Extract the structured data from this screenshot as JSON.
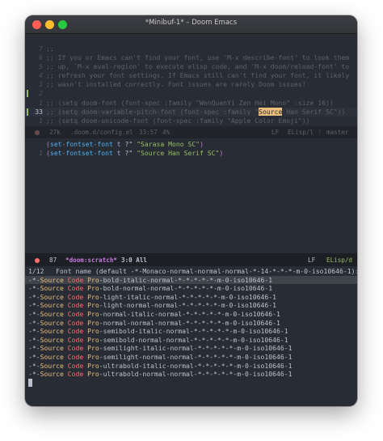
{
  "window": {
    "title": "*Minibuf-1* – Doom Emacs"
  },
  "top_pane": {
    "lines": [
      {
        "num": "7",
        "text": ";;"
      },
      {
        "num": "6",
        "text": ";; If you or Emacs can't find your font, use 'M-x describe-font' to look them"
      },
      {
        "num": "5",
        "text": ";; up, `M-x eval-region' to execute elisp code, and 'M-x doom/reload-font' to"
      },
      {
        "num": "4",
        "text": ";; refresh your font settings. If Emacs still can't find your font, it likely"
      },
      {
        "num": "3",
        "text": ";; wasn't installed correctly. Font issues are rarely Doom issues!"
      },
      {
        "num": "2",
        "text": ""
      },
      {
        "num": "1",
        "text": ";; (setq doom-font (font-spec :family \"WenQuanYi Zen Hei Mono\" :size 16))"
      },
      {
        "num": "33",
        "text_before": ";; (setq doom-variable-pitch-font (font-spec :family \"",
        "text_hl": "Source",
        "text_after": " Han Serif SC\"))"
      },
      {
        "num": "1",
        "text": ";; (setq doom-unicode-font (font-spec :family \"Apple Color Emoji\"))"
      },
      {
        "num": "2",
        "text": ""
      }
    ]
  },
  "top_modeline": {
    "size": "27k",
    "file": ".doom.d/config.el",
    "position": "33:57",
    "percent": "4%",
    "eol": "LF",
    "mode": "ELisp/l",
    "branch": "master"
  },
  "bottom_pane": {
    "lines": [
      {
        "num": "",
        "open": "(",
        "fn": "set-fontset-font",
        "sp1": " ",
        "const": "t",
        "sp2": " ",
        "char": "?\"",
        "sp3": " ",
        "str": "\"Sarasa Mono SC\"",
        "close": ")"
      },
      {
        "num": "1",
        "open": "(",
        "fn": "set-fontset-font",
        "sp1": " ",
        "const": "t",
        "sp2": " ",
        "char": "?\"",
        "sp3": " ",
        "str": "\"Source Han Serif SC\"",
        "close": ")"
      }
    ]
  },
  "bottom_modeline": {
    "line_num": "87",
    "buffer": "*doom:scratch*",
    "position": "3:0 All",
    "eol": "LF",
    "mode": "ELisp/d"
  },
  "minibuffer": {
    "prompt": "1/12   Font name (default -*-Monaco-normal-normal-normal-*-14-*-*-*-m-0-iso10646-1): Source ",
    "candidates": [
      "-bold-italic-normal-*-*-*-*-*-m-0-iso10646-1",
      "-bold-normal-normal-*-*-*-*-*-m-0-iso10646-1",
      "-light-italic-normal-*-*-*-*-*-m-0-iso10646-1",
      "-light-normal-normal-*-*-*-*-*-m-0-iso10646-1",
      "-normal-italic-normal-*-*-*-*-*-m-0-iso10646-1",
      "-normal-normal-normal-*-*-*-*-*-m-0-iso10646-1",
      "-semibold-italic-normal-*-*-*-*-*-m-0-iso10646-1",
      "-semibold-normal-normal-*-*-*-*-*-m-0-iso10646-1",
      "-semilight-italic-normal-*-*-*-*-*-m-0-iso10646-1",
      "-semilight-normal-normal-*-*-*-*-*-m-0-iso10646-1",
      "-ultrabold-italic-normal-*-*-*-*-*-m-0-iso10646-1",
      "-ultrabold-normal-normal-*-*-*-*-*-m-0-iso10646-1"
    ],
    "candidate_prefix": "-*-",
    "match_src": "Source",
    "match_code": "Code",
    "match_pro": "Pro"
  },
  "colors": {
    "background": "#282c34",
    "comment": "#5b6268",
    "keyword": "#c678dd",
    "function": "#51afef",
    "string": "#98be65",
    "highlight": "#ecbe7b",
    "error": "#ff6c6b"
  }
}
